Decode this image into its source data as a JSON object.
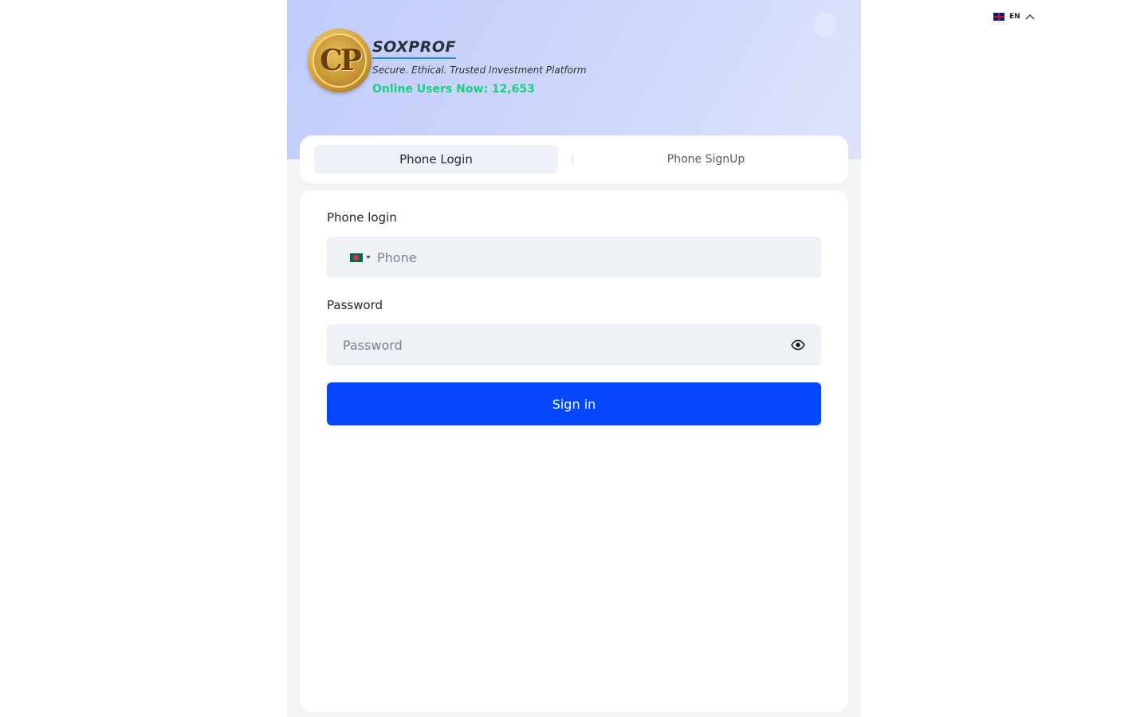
{
  "language": {
    "code": "EN",
    "flag_icon": "uk-flag-icon"
  },
  "brand": {
    "logo_text": "CP",
    "name": "SOXPROF",
    "tagline": "Secure. Ethical. Trusted Investment Platform",
    "online_users": "Online Users Now: 12,653"
  },
  "tabs": [
    {
      "label": "Phone Login",
      "active": true
    },
    {
      "label": "Phone SignUp",
      "active": false
    }
  ],
  "form": {
    "phone_label": "Phone login",
    "phone_placeholder": "Phone",
    "phone_value": "",
    "country_flag_icon": "bangladesh-flag-icon",
    "password_label": "Password",
    "password_placeholder": "Password",
    "password_value": "",
    "submit_label": "Sign in"
  },
  "colors": {
    "primary": "#0447ff",
    "online_text": "#1ccf7e",
    "hero_gradient_start": "#c0ccfb",
    "hero_gradient_end": "#dee2fb"
  }
}
